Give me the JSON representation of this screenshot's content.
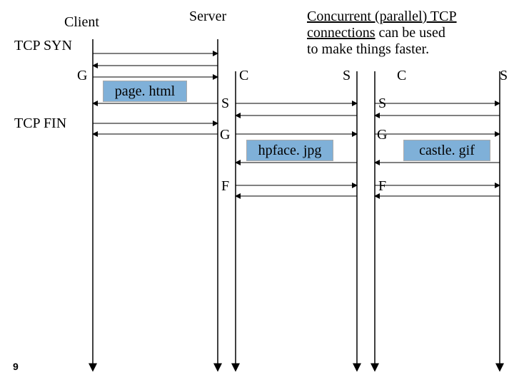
{
  "header": {
    "client": "Client",
    "server": "Server"
  },
  "left": {
    "syn": "TCP SYN",
    "g": "G",
    "fin": "TCP FIN",
    "page": "page. html"
  },
  "desc": {
    "line1a": "Concurrent (parallel) TCP",
    "line2a": "connections",
    "line2b": " can be used",
    "line3": "to make things faster."
  },
  "mid": {
    "c": "C",
    "s_label": "S",
    "s": "S",
    "g": "G",
    "f": "F",
    "file": "hpface. jpg"
  },
  "right": {
    "c": "C",
    "s_label": "S",
    "s": "S",
    "g": "G",
    "f": "F",
    "file": "castle. gif"
  },
  "slide": "9"
}
